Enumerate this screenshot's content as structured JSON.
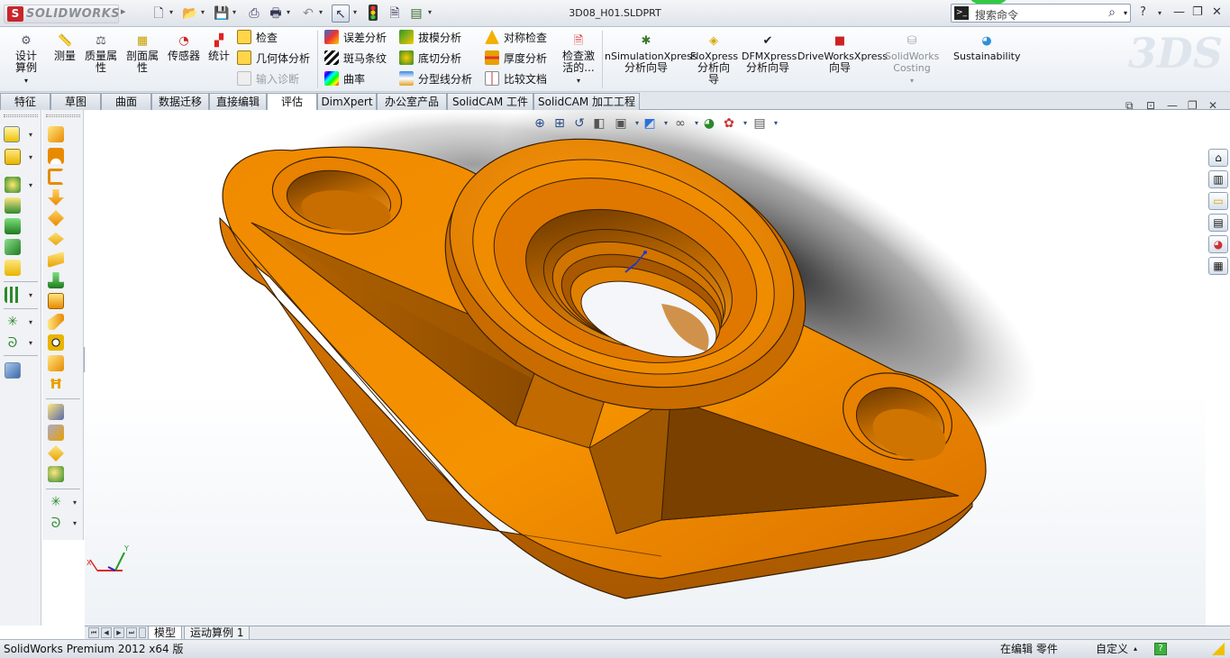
{
  "app": {
    "logo_text": "SOLIDWORKS",
    "logo_mark": "S",
    "document_title": "3D08_H01.SLDPRT"
  },
  "titlebar": {
    "search_placeholder": "搜索命令",
    "help_icon": "?",
    "quick_access": [
      "new-document-icon",
      "open-icon",
      "save-icon",
      "print-icon",
      "undo-icon",
      "select-icon",
      "rebuild-icon",
      "file-properties-icon",
      "options-icon"
    ]
  },
  "ribbon": {
    "design_study": "设计算例",
    "measure": "测量",
    "mass_properties": "质量属性",
    "section_properties": "剖面属性",
    "sensors": "传感器",
    "statistics": "统计",
    "check": "检查",
    "geometry_analysis": "几何体分析",
    "import_diagnostics": "输入诊断",
    "deviation_analysis": "误差分析",
    "zebra_stripes": "斑马条纹",
    "curvature": "曲率",
    "draft_analysis": "拔模分析",
    "undercut_analysis": "底切分析",
    "parting_line_analysis": "分型线分析",
    "symmetry_check": "对称检查",
    "thickness_analysis": "厚度分析",
    "compare_documents": "比较文档",
    "check_active": "检查激活的...",
    "simulation_xpress_1": "nSimulationXpress",
    "simulation_xpress_2": "分析向导",
    "floxpress_1": "FloXpress",
    "floxpress_2": "分析向",
    "floxpress_3": "导",
    "dfmxpress_1": "DFMXpress",
    "dfmxpress_2": "分析向导",
    "driveworks_1": "DriveWorksXpress",
    "driveworks_2": "向导",
    "costing_1": "SolidWorks",
    "costing_2": "Costing",
    "sustainability": "Sustainability",
    "watermark": "3DS"
  },
  "tabs": [
    "特征",
    "草图",
    "曲面",
    "数据迁移",
    "直接编辑",
    "评估",
    "DimXpert",
    "办公室产品",
    "SolidCAM 工件",
    "SolidCAM 加工工程"
  ],
  "active_tab": "评估",
  "bottom_tabs": {
    "model": "模型",
    "motion": "运动算例 1"
  },
  "status": {
    "product": "SolidWorks Premium 2012 x64 版",
    "editing": "在编辑 零件",
    "units": "自定义"
  },
  "colors": {
    "part_orange": "#e07a00",
    "part_dark": "#8a4b00",
    "accent_blue": "#2a4e8a"
  }
}
